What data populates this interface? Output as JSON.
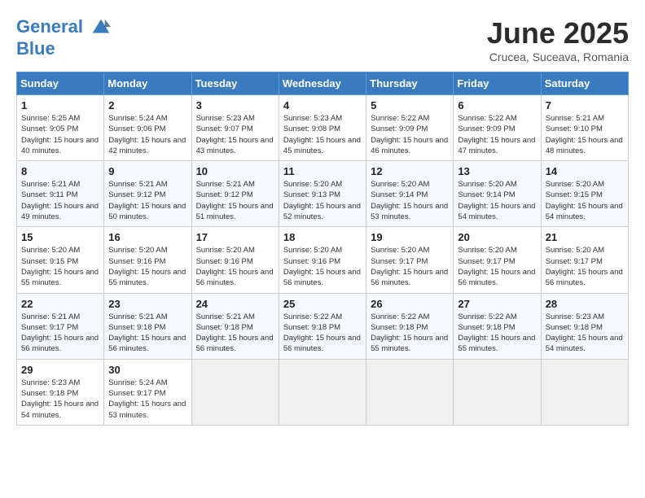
{
  "header": {
    "logo_line1": "General",
    "logo_line2": "Blue",
    "month_title": "June 2025",
    "subtitle": "Crucea, Suceava, Romania"
  },
  "weekdays": [
    "Sunday",
    "Monday",
    "Tuesday",
    "Wednesday",
    "Thursday",
    "Friday",
    "Saturday"
  ],
  "weeks": [
    [
      {
        "day": "1",
        "sunrise": "Sunrise: 5:25 AM",
        "sunset": "Sunset: 9:05 PM",
        "daylight": "Daylight: 15 hours and 40 minutes."
      },
      {
        "day": "2",
        "sunrise": "Sunrise: 5:24 AM",
        "sunset": "Sunset: 9:06 PM",
        "daylight": "Daylight: 15 hours and 42 minutes."
      },
      {
        "day": "3",
        "sunrise": "Sunrise: 5:23 AM",
        "sunset": "Sunset: 9:07 PM",
        "daylight": "Daylight: 15 hours and 43 minutes."
      },
      {
        "day": "4",
        "sunrise": "Sunrise: 5:23 AM",
        "sunset": "Sunset: 9:08 PM",
        "daylight": "Daylight: 15 hours and 45 minutes."
      },
      {
        "day": "5",
        "sunrise": "Sunrise: 5:22 AM",
        "sunset": "Sunset: 9:09 PM",
        "daylight": "Daylight: 15 hours and 46 minutes."
      },
      {
        "day": "6",
        "sunrise": "Sunrise: 5:22 AM",
        "sunset": "Sunset: 9:09 PM",
        "daylight": "Daylight: 15 hours and 47 minutes."
      },
      {
        "day": "7",
        "sunrise": "Sunrise: 5:21 AM",
        "sunset": "Sunset: 9:10 PM",
        "daylight": "Daylight: 15 hours and 48 minutes."
      }
    ],
    [
      {
        "day": "8",
        "sunrise": "Sunrise: 5:21 AM",
        "sunset": "Sunset: 9:11 PM",
        "daylight": "Daylight: 15 hours and 49 minutes."
      },
      {
        "day": "9",
        "sunrise": "Sunrise: 5:21 AM",
        "sunset": "Sunset: 9:12 PM",
        "daylight": "Daylight: 15 hours and 50 minutes."
      },
      {
        "day": "10",
        "sunrise": "Sunrise: 5:21 AM",
        "sunset": "Sunset: 9:12 PM",
        "daylight": "Daylight: 15 hours and 51 minutes."
      },
      {
        "day": "11",
        "sunrise": "Sunrise: 5:20 AM",
        "sunset": "Sunset: 9:13 PM",
        "daylight": "Daylight: 15 hours and 52 minutes."
      },
      {
        "day": "12",
        "sunrise": "Sunrise: 5:20 AM",
        "sunset": "Sunset: 9:14 PM",
        "daylight": "Daylight: 15 hours and 53 minutes."
      },
      {
        "day": "13",
        "sunrise": "Sunrise: 5:20 AM",
        "sunset": "Sunset: 9:14 PM",
        "daylight": "Daylight: 15 hours and 54 minutes."
      },
      {
        "day": "14",
        "sunrise": "Sunrise: 5:20 AM",
        "sunset": "Sunset: 9:15 PM",
        "daylight": "Daylight: 15 hours and 54 minutes."
      }
    ],
    [
      {
        "day": "15",
        "sunrise": "Sunrise: 5:20 AM",
        "sunset": "Sunset: 9:15 PM",
        "daylight": "Daylight: 15 hours and 55 minutes."
      },
      {
        "day": "16",
        "sunrise": "Sunrise: 5:20 AM",
        "sunset": "Sunset: 9:16 PM",
        "daylight": "Daylight: 15 hours and 55 minutes."
      },
      {
        "day": "17",
        "sunrise": "Sunrise: 5:20 AM",
        "sunset": "Sunset: 9:16 PM",
        "daylight": "Daylight: 15 hours and 56 minutes."
      },
      {
        "day": "18",
        "sunrise": "Sunrise: 5:20 AM",
        "sunset": "Sunset: 9:16 PM",
        "daylight": "Daylight: 15 hours and 56 minutes."
      },
      {
        "day": "19",
        "sunrise": "Sunrise: 5:20 AM",
        "sunset": "Sunset: 9:17 PM",
        "daylight": "Daylight: 15 hours and 56 minutes."
      },
      {
        "day": "20",
        "sunrise": "Sunrise: 5:20 AM",
        "sunset": "Sunset: 9:17 PM",
        "daylight": "Daylight: 15 hours and 56 minutes."
      },
      {
        "day": "21",
        "sunrise": "Sunrise: 5:20 AM",
        "sunset": "Sunset: 9:17 PM",
        "daylight": "Daylight: 15 hours and 56 minutes."
      }
    ],
    [
      {
        "day": "22",
        "sunrise": "Sunrise: 5:21 AM",
        "sunset": "Sunset: 9:17 PM",
        "daylight": "Daylight: 15 hours and 56 minutes."
      },
      {
        "day": "23",
        "sunrise": "Sunrise: 5:21 AM",
        "sunset": "Sunset: 9:18 PM",
        "daylight": "Daylight: 15 hours and 56 minutes."
      },
      {
        "day": "24",
        "sunrise": "Sunrise: 5:21 AM",
        "sunset": "Sunset: 9:18 PM",
        "daylight": "Daylight: 15 hours and 56 minutes."
      },
      {
        "day": "25",
        "sunrise": "Sunrise: 5:22 AM",
        "sunset": "Sunset: 9:18 PM",
        "daylight": "Daylight: 15 hours and 56 minutes."
      },
      {
        "day": "26",
        "sunrise": "Sunrise: 5:22 AM",
        "sunset": "Sunset: 9:18 PM",
        "daylight": "Daylight: 15 hours and 55 minutes."
      },
      {
        "day": "27",
        "sunrise": "Sunrise: 5:22 AM",
        "sunset": "Sunset: 9:18 PM",
        "daylight": "Daylight: 15 hours and 55 minutes."
      },
      {
        "day": "28",
        "sunrise": "Sunrise: 5:23 AM",
        "sunset": "Sunset: 9:18 PM",
        "daylight": "Daylight: 15 hours and 54 minutes."
      }
    ],
    [
      {
        "day": "29",
        "sunrise": "Sunrise: 5:23 AM",
        "sunset": "Sunset: 9:18 PM",
        "daylight": "Daylight: 15 hours and 54 minutes."
      },
      {
        "day": "30",
        "sunrise": "Sunrise: 5:24 AM",
        "sunset": "Sunset: 9:17 PM",
        "daylight": "Daylight: 15 hours and 53 minutes."
      },
      null,
      null,
      null,
      null,
      null
    ]
  ]
}
